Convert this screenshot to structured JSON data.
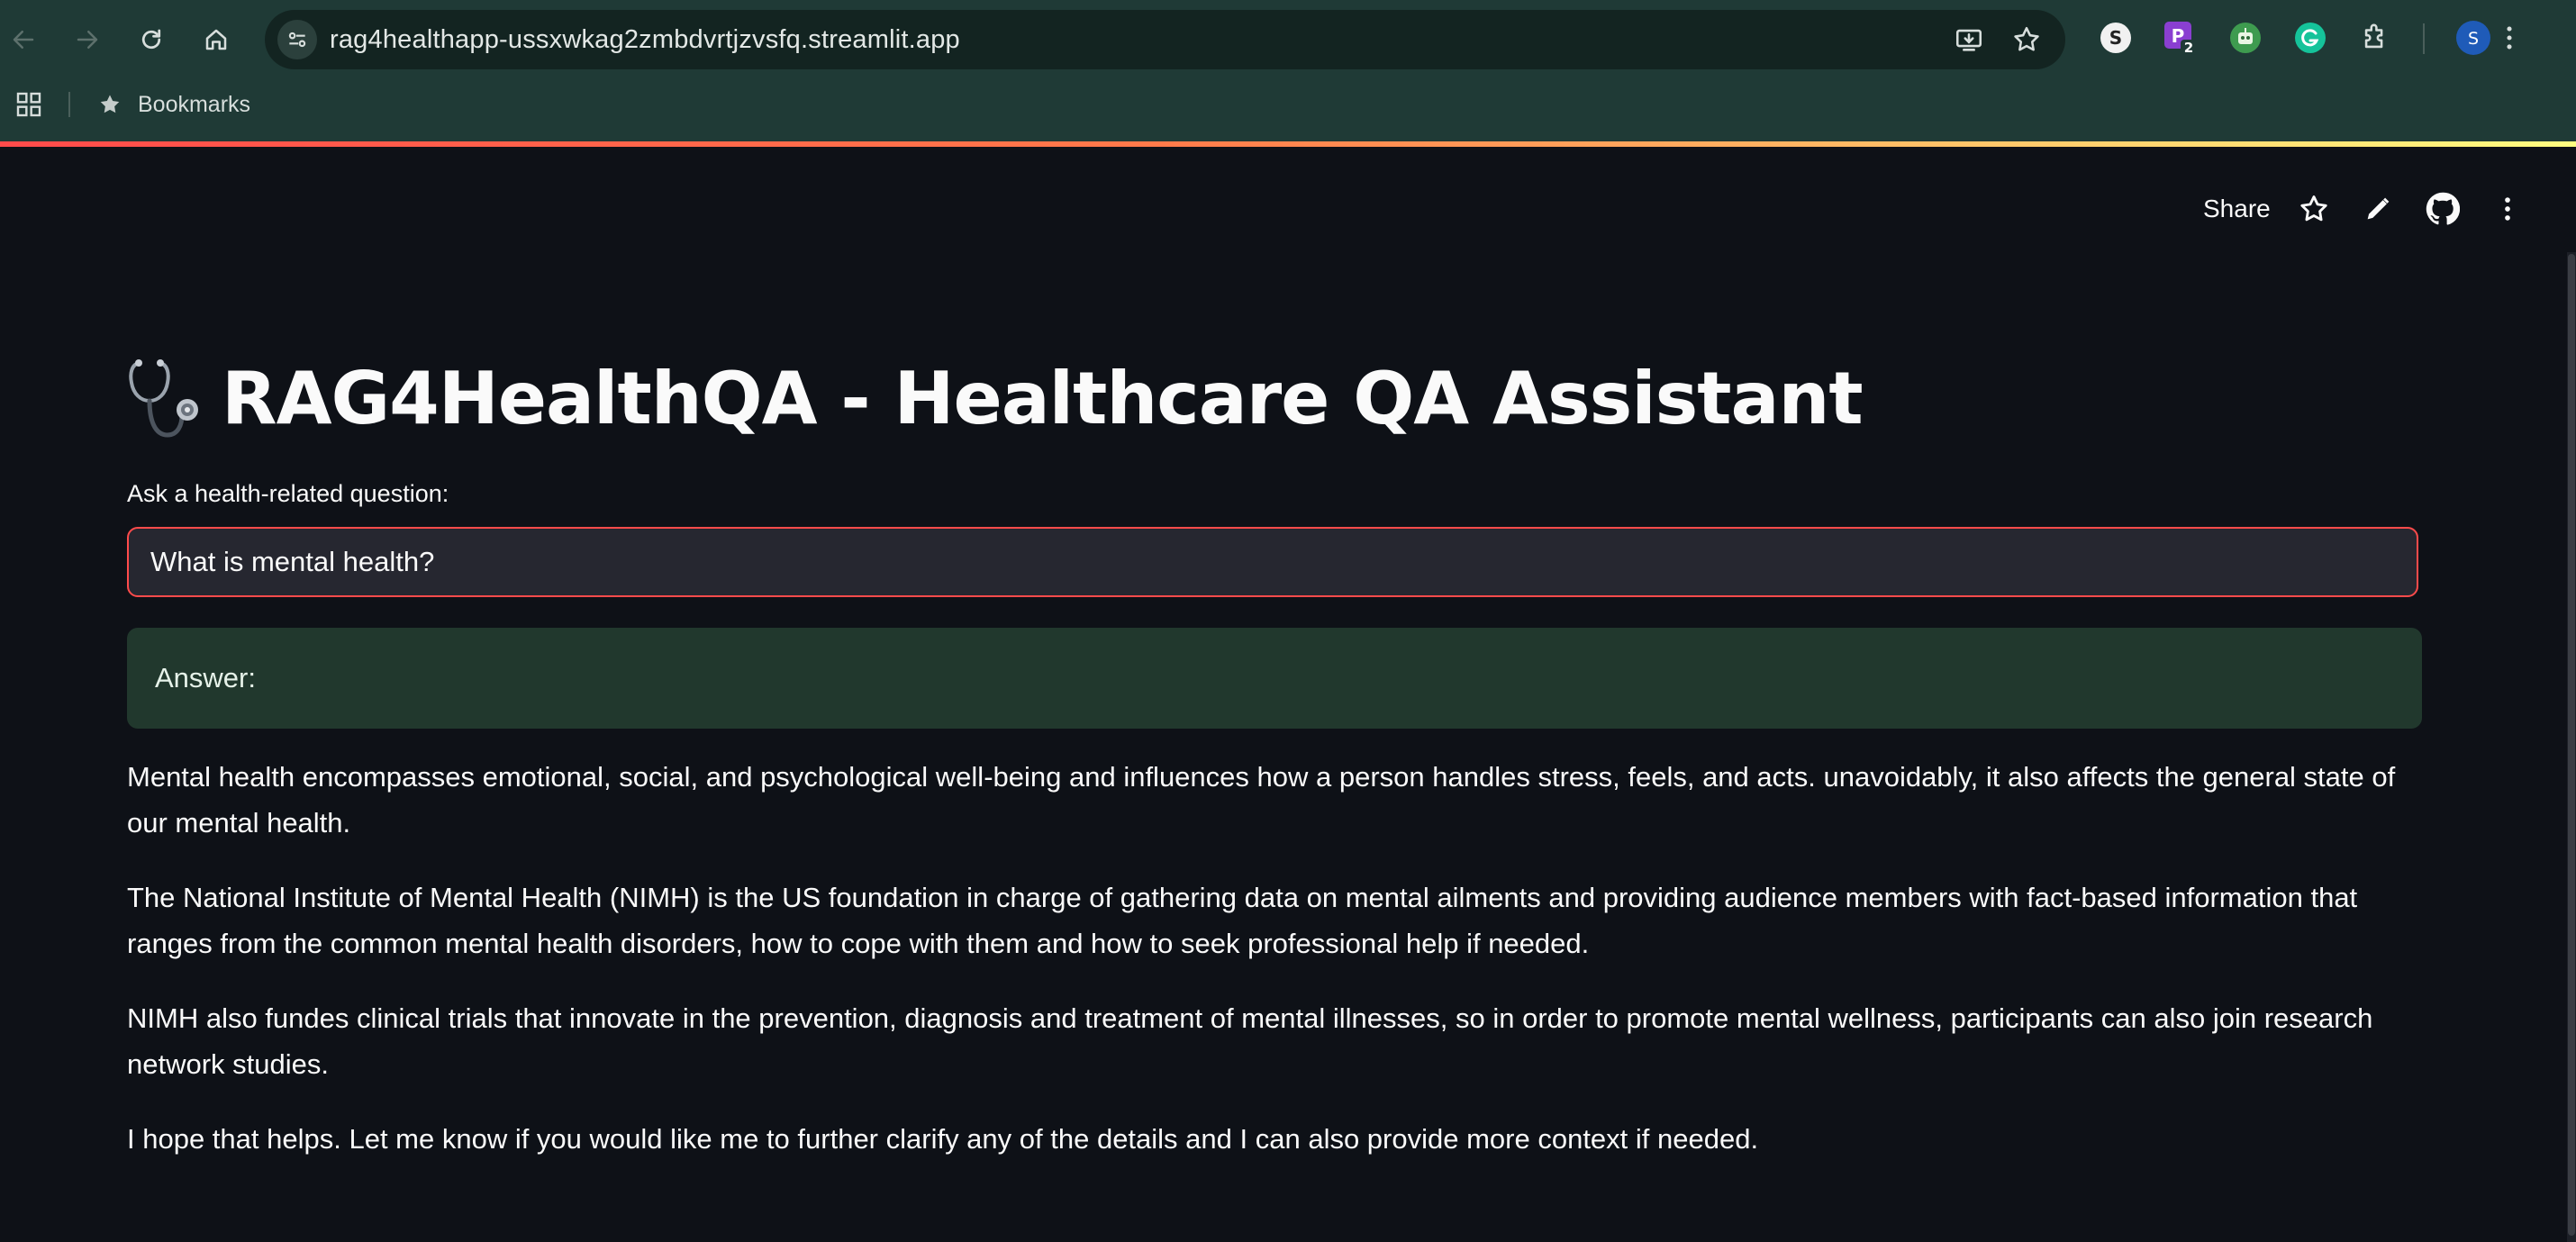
{
  "browser": {
    "url": "rag4healthapp-ussxwkag2zmbdvrtjzvsfq.streamlit.app",
    "bookmarks_label": "Bookmarks",
    "extension_badge": "2",
    "profile_initial": "S",
    "extension_s_initial": "S",
    "extension_p_initial": "P"
  },
  "app_header": {
    "share_label": "Share"
  },
  "main": {
    "title": "RAG4HealthQA - Healthcare QA Assistant",
    "question_label": "Ask a health-related question:",
    "question_value": "What is mental health?",
    "answer_heading": "Answer:",
    "answer_paragraphs": [
      "Mental health encompasses emotional, social, and psychological well-being and influences how a person handles stress, feels, and acts. unavoidably, it also affects the general state of our mental health.",
      "The National Institute of Mental Health (NIMH) is the US foundation in charge of gathering data on mental ailments and providing audience members with fact-based information that ranges from the common mental health disorders, how to cope with them and how to seek professional help if needed.",
      "NIMH also fundes clinical trials that innovate in the prevention, diagnosis and treatment of mental illnesses, so in order to promote mental wellness, participants can also join research network studies.",
      "I hope that helps. Let me know if you would like me to further clarify any of the details and I can also provide more context if needed."
    ]
  },
  "colors": {
    "browser_chrome": "#1f3a36",
    "app_background": "#0e1117",
    "accent_red": "#ff4b4b",
    "answer_box": "#21382d",
    "input_background": "#262730"
  }
}
